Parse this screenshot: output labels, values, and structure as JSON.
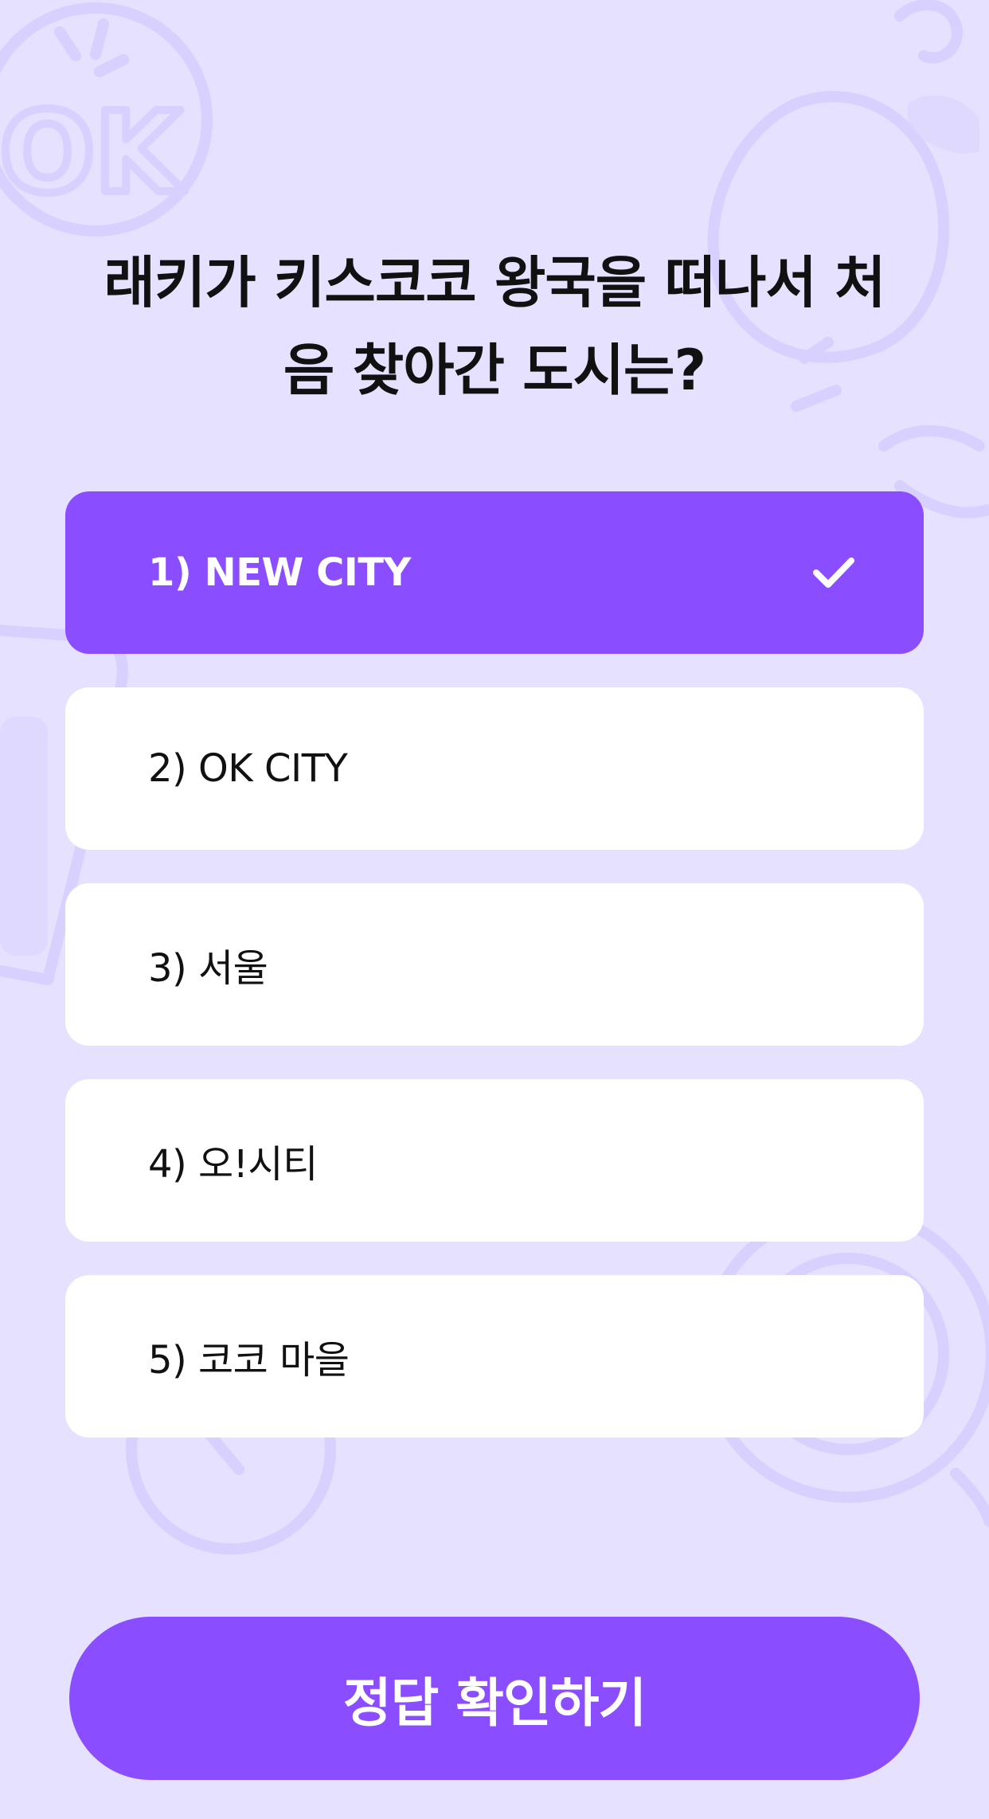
{
  "quiz": {
    "question_line1": "래키가 키스코코 왕국을 떠나서 처",
    "question_line2": "음 찾아간 도시는?",
    "options": [
      {
        "label": "1) NEW CITY",
        "selected": true
      },
      {
        "label": "2) OK CITY",
        "selected": false
      },
      {
        "label": "3) 서울",
        "selected": false
      },
      {
        "label": "4) 오!시티",
        "selected": false
      },
      {
        "label": "5) 코코 마을",
        "selected": false
      }
    ],
    "confirm_label": "정답 확인하기"
  },
  "icons": {
    "selected_marker": "check-icon"
  },
  "colors": {
    "background": "#e6e1ff",
    "accent": "#8a4dff",
    "option_background": "#ffffff",
    "deco_outline": "#d6cdff"
  }
}
